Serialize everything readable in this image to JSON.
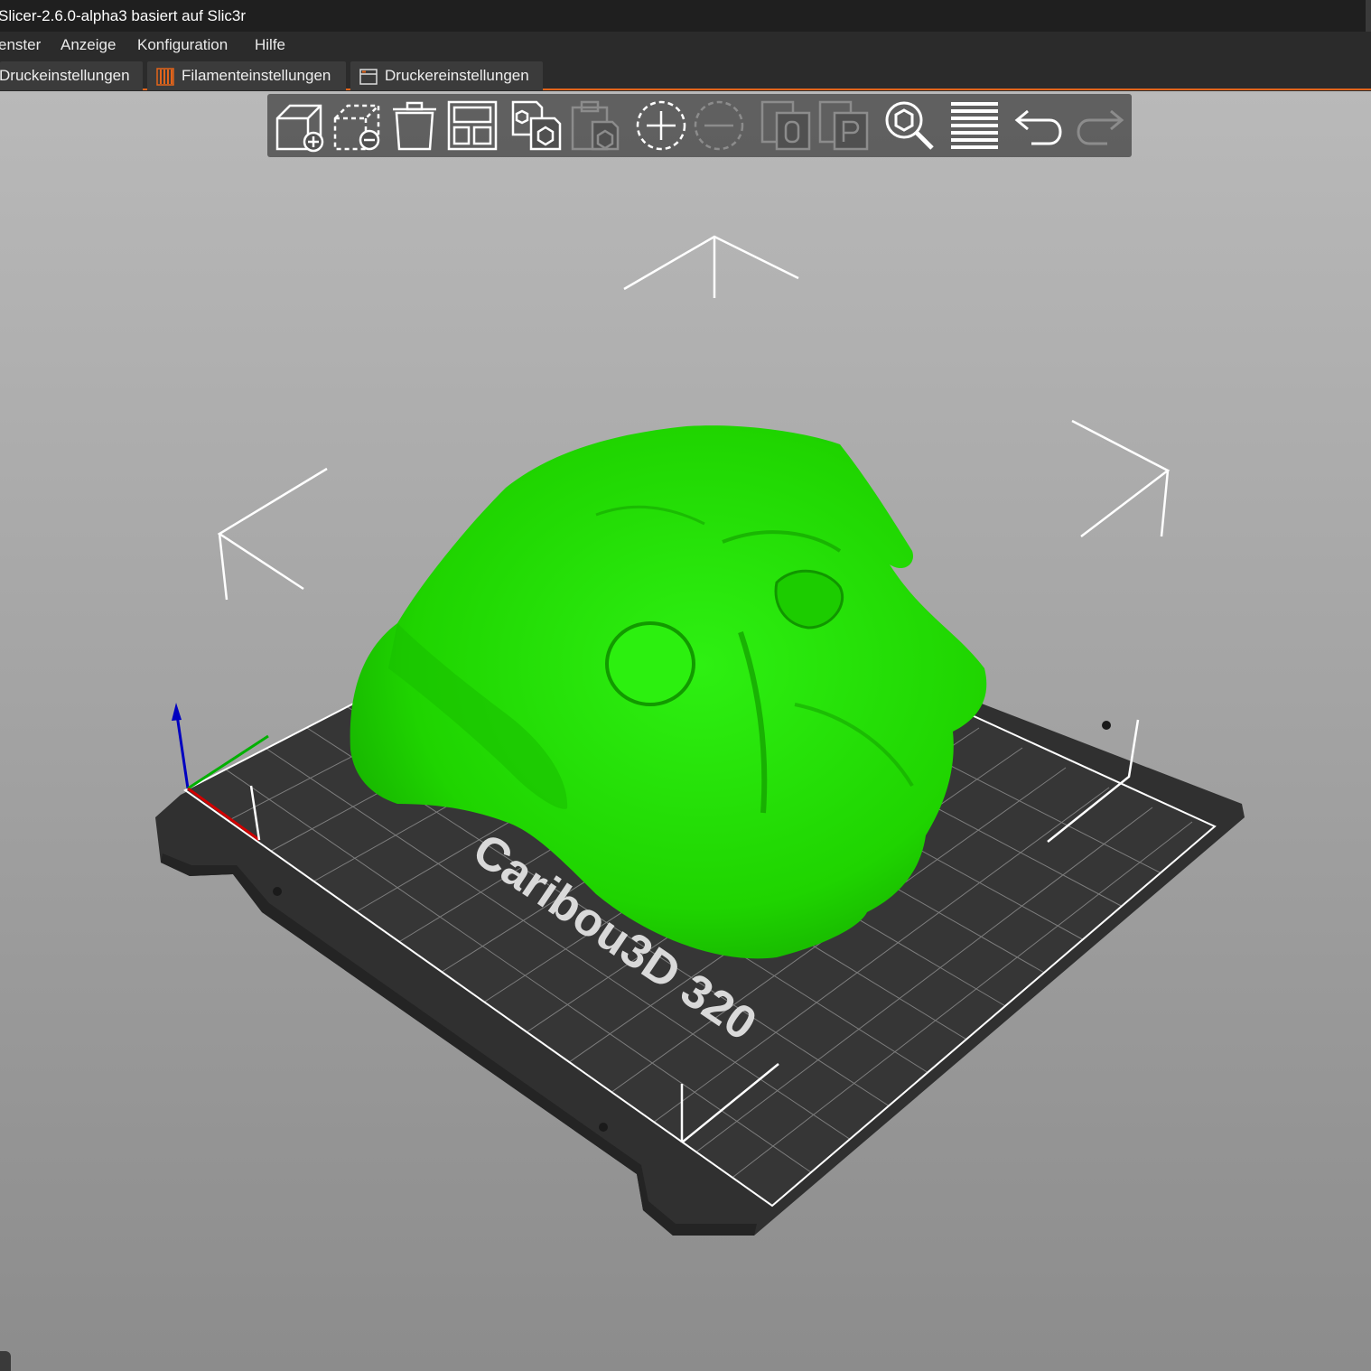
{
  "window": {
    "title": "Slicer-2.6.0-alpha3 basiert auf Slic3r"
  },
  "menubar": {
    "items": [
      {
        "label": "enster"
      },
      {
        "label": "Anzeige"
      },
      {
        "label": "Konfiguration"
      },
      {
        "label": "Hilfe"
      }
    ]
  },
  "tabs": [
    {
      "label": "Druckeinstellungen",
      "icon": "print-settings-icon"
    },
    {
      "label": "Filamenteinstellungen",
      "icon": "filament-spool-icon"
    },
    {
      "label": "Druckereinstellungen",
      "icon": "printer-settings-icon"
    }
  ],
  "toolbar": {
    "buttons": [
      {
        "name": "add-object",
        "icon": "cube-add-icon",
        "enabled": true
      },
      {
        "name": "delete",
        "icon": "cube-remove-icon",
        "enabled": true
      },
      {
        "name": "delete-all",
        "icon": "trash-icon",
        "enabled": true
      },
      {
        "name": "arrange",
        "icon": "arrange-icon",
        "enabled": true
      },
      {
        "name": "copy",
        "icon": "copy-icon",
        "enabled": true
      },
      {
        "name": "paste",
        "icon": "paste-icon",
        "enabled": false
      },
      {
        "name": "add-instance",
        "icon": "plus-circle-icon",
        "enabled": true
      },
      {
        "name": "remove-instance",
        "icon": "minus-circle-icon",
        "enabled": false
      },
      {
        "name": "split-objects",
        "icon": "split-objects-icon",
        "enabled": false
      },
      {
        "name": "split-parts",
        "icon": "split-parts-icon",
        "enabled": false
      },
      {
        "name": "search",
        "icon": "search-icon",
        "enabled": true
      },
      {
        "name": "layers-editing",
        "icon": "layers-icon",
        "enabled": true
      },
      {
        "name": "undo",
        "icon": "undo-icon",
        "enabled": true
      },
      {
        "name": "redo",
        "icon": "redo-icon",
        "enabled": false
      }
    ]
  },
  "scene": {
    "bed_label": "Caribou3D 320",
    "model_color": "#22e000",
    "bed_color": "#2f2f2f",
    "grid_color": "#ffffff",
    "accent_color": "#e3641b",
    "axes": {
      "x_color": "#d00000",
      "y_color": "#00b000",
      "z_color": "#0000c0"
    }
  }
}
